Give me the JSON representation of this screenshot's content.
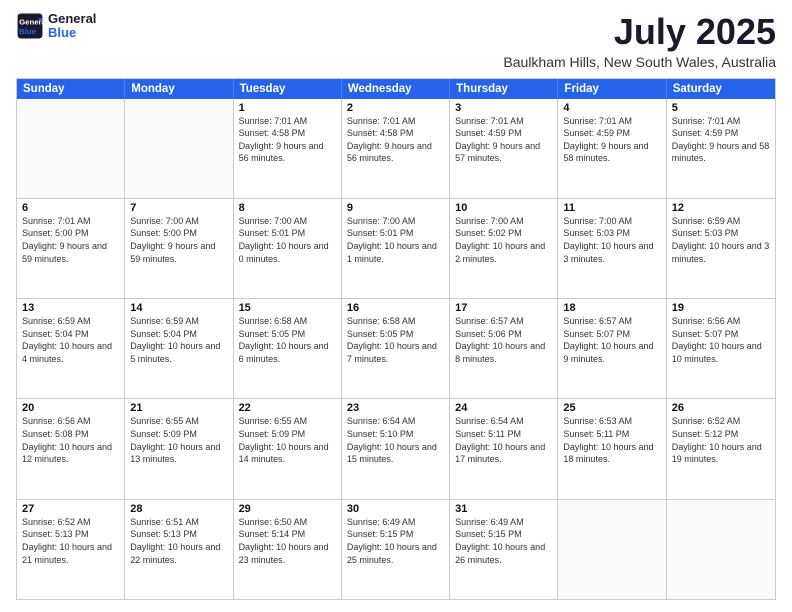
{
  "logo": {
    "line1": "General",
    "line2": "Blue"
  },
  "title": "July 2025",
  "subtitle": "Baulkham Hills, New South Wales, Australia",
  "days_of_week": [
    "Sunday",
    "Monday",
    "Tuesday",
    "Wednesday",
    "Thursday",
    "Friday",
    "Saturday"
  ],
  "weeks": [
    [
      {
        "day": "",
        "info": ""
      },
      {
        "day": "",
        "info": ""
      },
      {
        "day": "1",
        "info": "Sunrise: 7:01 AM\nSunset: 4:58 PM\nDaylight: 9 hours and 56 minutes."
      },
      {
        "day": "2",
        "info": "Sunrise: 7:01 AM\nSunset: 4:58 PM\nDaylight: 9 hours and 56 minutes."
      },
      {
        "day": "3",
        "info": "Sunrise: 7:01 AM\nSunset: 4:59 PM\nDaylight: 9 hours and 57 minutes."
      },
      {
        "day": "4",
        "info": "Sunrise: 7:01 AM\nSunset: 4:59 PM\nDaylight: 9 hours and 58 minutes."
      },
      {
        "day": "5",
        "info": "Sunrise: 7:01 AM\nSunset: 4:59 PM\nDaylight: 9 hours and 58 minutes."
      }
    ],
    [
      {
        "day": "6",
        "info": "Sunrise: 7:01 AM\nSunset: 5:00 PM\nDaylight: 9 hours and 59 minutes."
      },
      {
        "day": "7",
        "info": "Sunrise: 7:00 AM\nSunset: 5:00 PM\nDaylight: 9 hours and 59 minutes."
      },
      {
        "day": "8",
        "info": "Sunrise: 7:00 AM\nSunset: 5:01 PM\nDaylight: 10 hours and 0 minutes."
      },
      {
        "day": "9",
        "info": "Sunrise: 7:00 AM\nSunset: 5:01 PM\nDaylight: 10 hours and 1 minute."
      },
      {
        "day": "10",
        "info": "Sunrise: 7:00 AM\nSunset: 5:02 PM\nDaylight: 10 hours and 2 minutes."
      },
      {
        "day": "11",
        "info": "Sunrise: 7:00 AM\nSunset: 5:03 PM\nDaylight: 10 hours and 3 minutes."
      },
      {
        "day": "12",
        "info": "Sunrise: 6:59 AM\nSunset: 5:03 PM\nDaylight: 10 hours and 3 minutes."
      }
    ],
    [
      {
        "day": "13",
        "info": "Sunrise: 6:59 AM\nSunset: 5:04 PM\nDaylight: 10 hours and 4 minutes."
      },
      {
        "day": "14",
        "info": "Sunrise: 6:59 AM\nSunset: 5:04 PM\nDaylight: 10 hours and 5 minutes."
      },
      {
        "day": "15",
        "info": "Sunrise: 6:58 AM\nSunset: 5:05 PM\nDaylight: 10 hours and 6 minutes."
      },
      {
        "day": "16",
        "info": "Sunrise: 6:58 AM\nSunset: 5:05 PM\nDaylight: 10 hours and 7 minutes."
      },
      {
        "day": "17",
        "info": "Sunrise: 6:57 AM\nSunset: 5:06 PM\nDaylight: 10 hours and 8 minutes."
      },
      {
        "day": "18",
        "info": "Sunrise: 6:57 AM\nSunset: 5:07 PM\nDaylight: 10 hours and 9 minutes."
      },
      {
        "day": "19",
        "info": "Sunrise: 6:56 AM\nSunset: 5:07 PM\nDaylight: 10 hours and 10 minutes."
      }
    ],
    [
      {
        "day": "20",
        "info": "Sunrise: 6:56 AM\nSunset: 5:08 PM\nDaylight: 10 hours and 12 minutes."
      },
      {
        "day": "21",
        "info": "Sunrise: 6:55 AM\nSunset: 5:09 PM\nDaylight: 10 hours and 13 minutes."
      },
      {
        "day": "22",
        "info": "Sunrise: 6:55 AM\nSunset: 5:09 PM\nDaylight: 10 hours and 14 minutes."
      },
      {
        "day": "23",
        "info": "Sunrise: 6:54 AM\nSunset: 5:10 PM\nDaylight: 10 hours and 15 minutes."
      },
      {
        "day": "24",
        "info": "Sunrise: 6:54 AM\nSunset: 5:11 PM\nDaylight: 10 hours and 17 minutes."
      },
      {
        "day": "25",
        "info": "Sunrise: 6:53 AM\nSunset: 5:11 PM\nDaylight: 10 hours and 18 minutes."
      },
      {
        "day": "26",
        "info": "Sunrise: 6:52 AM\nSunset: 5:12 PM\nDaylight: 10 hours and 19 minutes."
      }
    ],
    [
      {
        "day": "27",
        "info": "Sunrise: 6:52 AM\nSunset: 5:13 PM\nDaylight: 10 hours and 21 minutes."
      },
      {
        "day": "28",
        "info": "Sunrise: 6:51 AM\nSunset: 5:13 PM\nDaylight: 10 hours and 22 minutes."
      },
      {
        "day": "29",
        "info": "Sunrise: 6:50 AM\nSunset: 5:14 PM\nDaylight: 10 hours and 23 minutes."
      },
      {
        "day": "30",
        "info": "Sunrise: 6:49 AM\nSunset: 5:15 PM\nDaylight: 10 hours and 25 minutes."
      },
      {
        "day": "31",
        "info": "Sunrise: 6:49 AM\nSunset: 5:15 PM\nDaylight: 10 hours and 26 minutes."
      },
      {
        "day": "",
        "info": ""
      },
      {
        "day": "",
        "info": ""
      }
    ]
  ]
}
